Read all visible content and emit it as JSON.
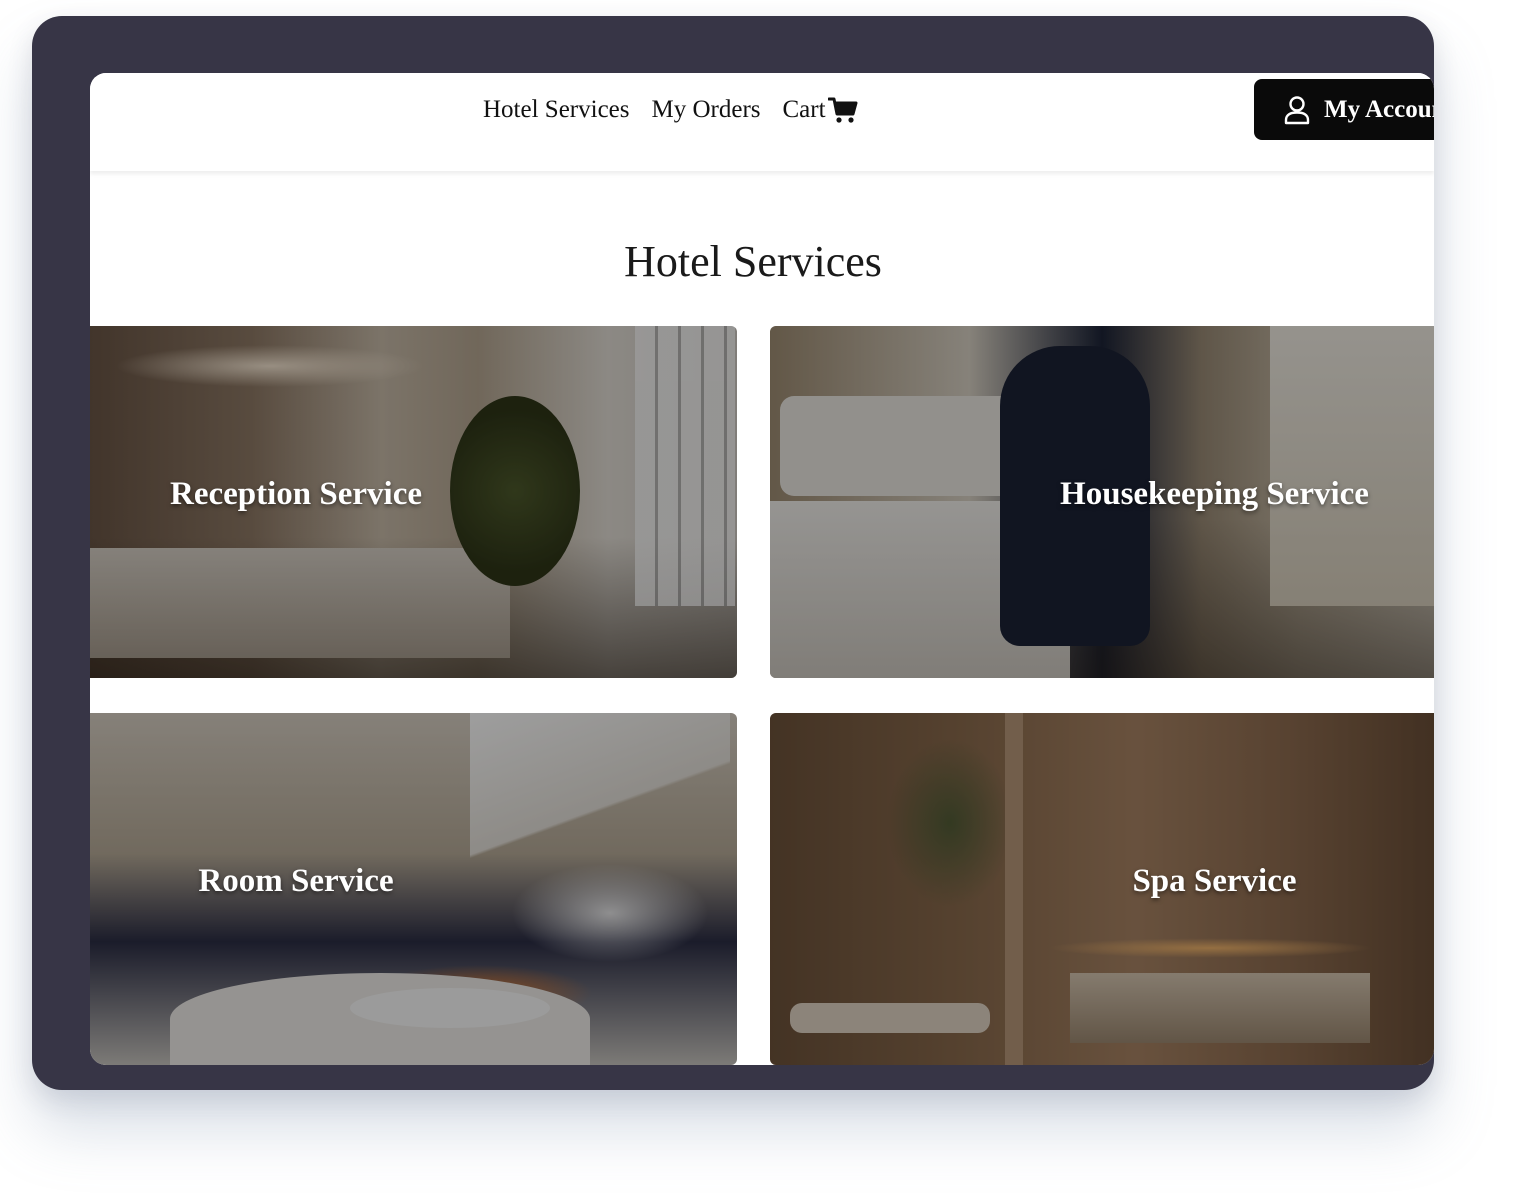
{
  "nav": {
    "links": [
      {
        "label": "Hotel Services"
      },
      {
        "label": "My Orders"
      },
      {
        "label": "Cart"
      }
    ],
    "account_label": "My Account"
  },
  "page": {
    "title": "Hotel Services"
  },
  "services": [
    {
      "label": "Reception Service",
      "icon": "reception-photo"
    },
    {
      "label": "Housekeeping Service",
      "icon": "housekeeping-photo"
    },
    {
      "label": "Room Service",
      "icon": "room-service-photo"
    },
    {
      "label": "Spa Service",
      "icon": "spa-photo"
    }
  ],
  "colors": {
    "device_frame": "#373546",
    "account_button": "#0a0a0a",
    "card_text": "#ffffff"
  }
}
